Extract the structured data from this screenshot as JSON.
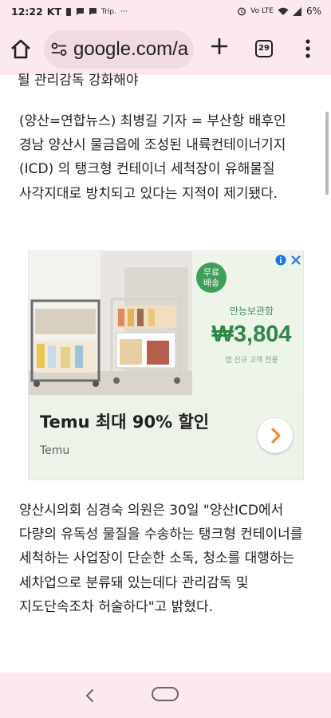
{
  "status_bar": {
    "time": "12:22",
    "carrier": "KT",
    "notif_app": "Trip.",
    "more": "···",
    "network": "Vo LTE",
    "battery": "6%"
  },
  "browser": {
    "url": "google.com/a",
    "tab_count": "29"
  },
  "article": {
    "cut_heading": "될 관리감독 강화해야",
    "paragraph1": "(양산=연합뉴스) 최병길 기자 = 부산항 배후인 경남 양산시 물금읍에 조성된 내륙컨테이너기지(ICD) 의 탱크형 컨테이너 세척장이 유해물질 사각지대로 방치되고 있다는 지적이 제기됐다.",
    "paragraph2": "양산시의회 심경숙 의원은 30일 \"양산ICD에서 다량의 유독성 물질을 수송하는 탱크형 컨테이너를 세척하는 사업장이 단순한 소독, 청소를 대행하는 세차업으로 분류돼 있는데다 관리감독 및 지도단속조차 허술하다\"고 밝혔다."
  },
  "ad": {
    "badge_line1": "무료",
    "badge_line2": "배송",
    "promo_label": "만능보관함",
    "price": "₩3,804",
    "fine_print": "앱 신규 고객 전용",
    "headline": "Temu 최대 90% 할인",
    "advertiser": "Temu",
    "colors": {
      "accent": "#2f8747",
      "badge": "#3f9f58",
      "arrow": "#f0801e"
    }
  },
  "icons": [
    "home-icon",
    "site-info-icon",
    "plus-icon",
    "tabs-icon",
    "more-vert-icon",
    "ad-info-icon",
    "ad-close-icon",
    "chevron-right-icon",
    "nav-back-icon",
    "nav-home-icon"
  ]
}
